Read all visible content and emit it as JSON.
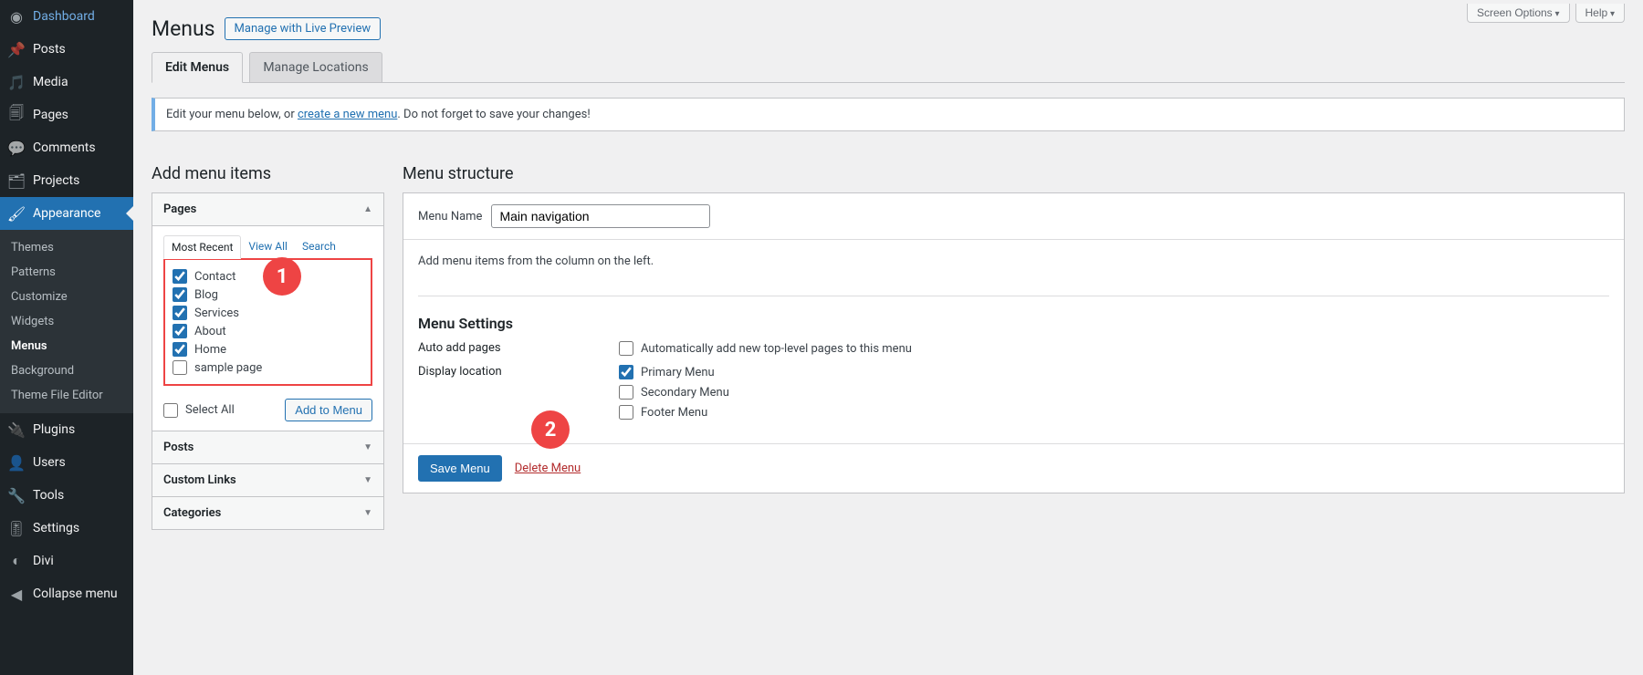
{
  "topButtons": {
    "screenOptions": "Screen Options",
    "help": "Help"
  },
  "sidebar": {
    "items": [
      {
        "label": "Dashboard"
      },
      {
        "label": "Posts"
      },
      {
        "label": "Media"
      },
      {
        "label": "Pages"
      },
      {
        "label": "Comments"
      },
      {
        "label": "Projects"
      },
      {
        "label": "Appearance"
      },
      {
        "label": "Plugins"
      },
      {
        "label": "Users"
      },
      {
        "label": "Tools"
      },
      {
        "label": "Settings"
      },
      {
        "label": "Divi"
      },
      {
        "label": "Collapse menu"
      }
    ],
    "submenu": [
      {
        "label": "Themes"
      },
      {
        "label": "Patterns"
      },
      {
        "label": "Customize"
      },
      {
        "label": "Widgets"
      },
      {
        "label": "Menus"
      },
      {
        "label": "Background"
      },
      {
        "label": "Theme File Editor"
      }
    ]
  },
  "header": {
    "title": "Menus",
    "previewBtn": "Manage with Live Preview"
  },
  "tabs": {
    "edit": "Edit Menus",
    "locations": "Manage Locations"
  },
  "notice": {
    "pre": "Edit your menu below, or ",
    "link": "create a new menu",
    "post": ". Do not forget to save your changes!"
  },
  "left": {
    "heading": "Add menu items",
    "accordions": {
      "pages": "Pages",
      "posts": "Posts",
      "customLinks": "Custom Links",
      "categories": "Categories"
    },
    "subtabs": {
      "recent": "Most Recent",
      "all": "View All",
      "search": "Search"
    },
    "pageItems": [
      "Contact",
      "Blog",
      "Services",
      "About",
      "Home",
      "sample page"
    ],
    "selectAll": "Select All",
    "addToMenu": "Add to Menu"
  },
  "right": {
    "heading": "Menu structure",
    "menuNameLabel": "Menu Name",
    "menuNameValue": "Main navigation",
    "helper": "Add menu items from the column on the left.",
    "settingsHeading": "Menu Settings",
    "autoAddLabel": "Auto add pages",
    "autoAddOption": "Automatically add new top-level pages to this menu",
    "displayLabel": "Display location",
    "locations": [
      "Primary Menu",
      "Secondary Menu",
      "Footer Menu"
    ],
    "saveBtn": "Save Menu",
    "deleteBtn": "Delete Menu"
  },
  "badges": {
    "one": "1",
    "two": "2"
  }
}
